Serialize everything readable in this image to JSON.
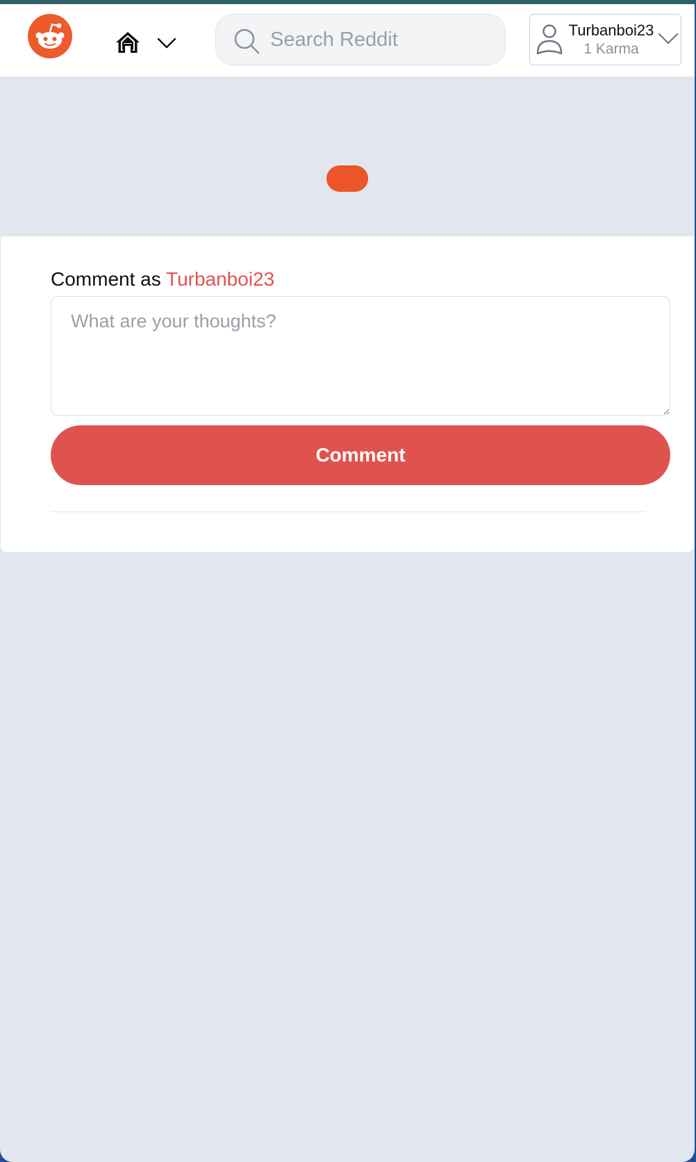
{
  "colors": {
    "brand": "#ed5a2b",
    "accent": "#df534f",
    "page_bg": "#e2e7ef",
    "card_bg": "#ffffff"
  },
  "navbar": {
    "logo_icon": "reddit-snoo-icon",
    "home_icon": "home-icon",
    "home_dropdown_icon": "chevron-down-icon",
    "search": {
      "icon": "search-icon",
      "placeholder": "Search Reddit",
      "value": ""
    },
    "user": {
      "avatar_icon": "user-outline-icon",
      "username": "Turbanboi23",
      "karma": "1 Karma",
      "dropdown_icon": "chevron-down-icon"
    }
  },
  "comment_form": {
    "label_prefix": "Comment as",
    "label_username": "Turbanboi23",
    "textarea_placeholder": "What are your thoughts?",
    "textarea_value": "",
    "submit_label": "Comment"
  }
}
